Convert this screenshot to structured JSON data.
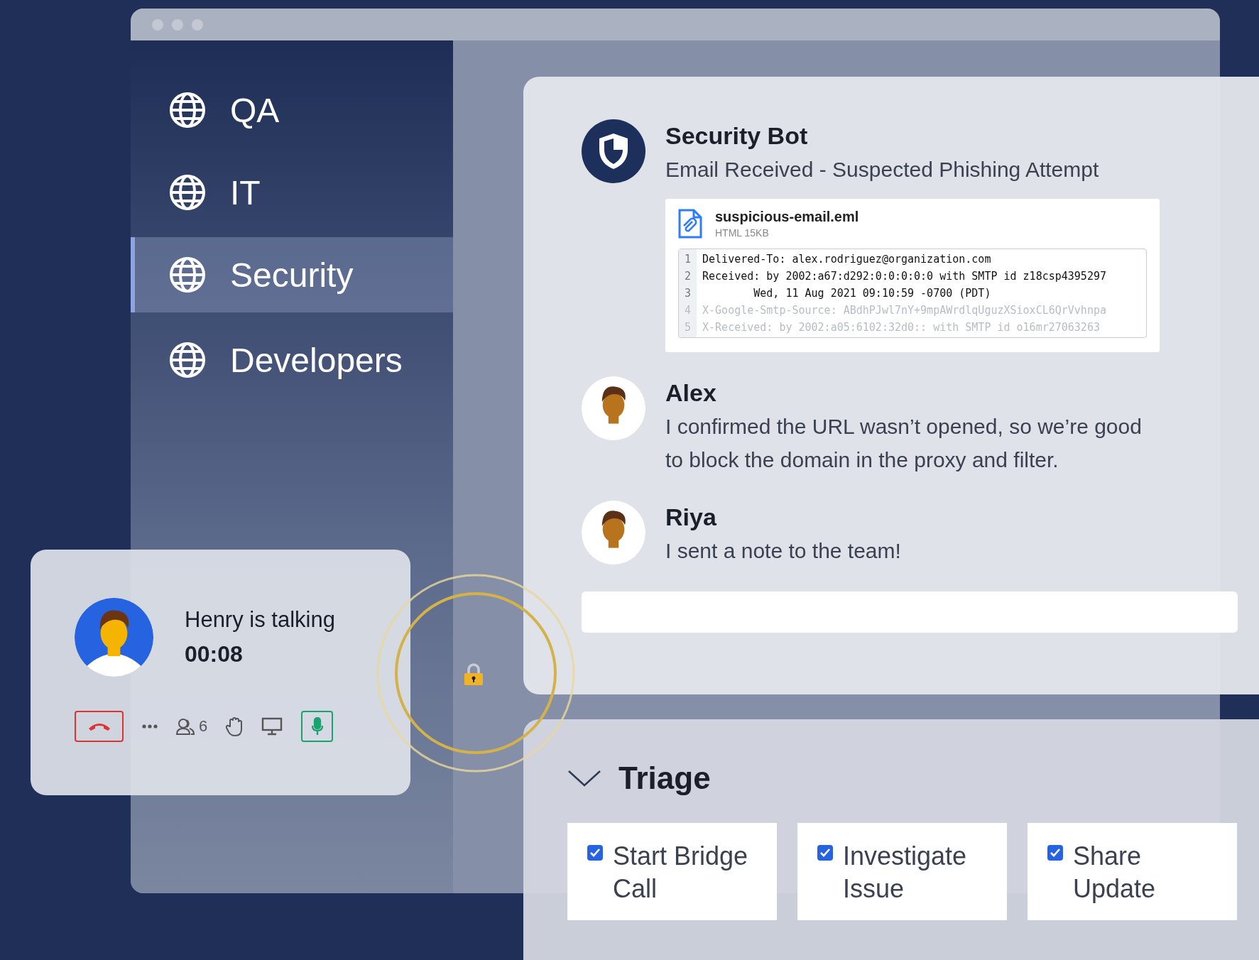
{
  "sidebar": {
    "items": [
      {
        "label": "QA",
        "selected": false
      },
      {
        "label": "IT",
        "selected": false
      },
      {
        "label": "Security",
        "selected": true
      },
      {
        "label": "Developers",
        "selected": false
      }
    ]
  },
  "chat": {
    "messages": [
      {
        "kind": "bot",
        "author": "Security Bot",
        "text": "Email Received - Suspected Phishing Attempt",
        "attachment": {
          "filename": "suspicious-email.eml",
          "meta": "HTML 15KB",
          "lines": [
            {
              "number": "1",
              "text": "Delivered-To: alex.rodriguez@organization.com",
              "faded": false
            },
            {
              "number": "2",
              "text": "Received: by 2002:a67:d292:0:0:0:0:0 with SMTP id z18csp4395297",
              "faded": false
            },
            {
              "number": "3",
              "text": "        Wed, 11 Aug 2021 09:10:59 -0700 (PDT)",
              "faded": false
            },
            {
              "number": "4",
              "text": "X-Google-Smtp-Source: ABdhPJwl7nY+9mpAWrdlqUguzXSioxCL6QrVvhnpa",
              "faded": true
            },
            {
              "number": "5",
              "text": "X-Received: by 2002:a05:6102:32d0:: with SMTP id o16mr27063263",
              "faded": true
            }
          ]
        }
      },
      {
        "kind": "person",
        "author": "Alex",
        "text": "I confirmed the URL wasn’t opened, so we’re good to block the domain in the proxy and filter."
      },
      {
        "kind": "person",
        "author": "Riya",
        "text": "I sent a note to the team!"
      }
    ]
  },
  "call": {
    "status": "Henry is talking",
    "duration": "00:08",
    "participants": "6",
    "mic_on": true
  },
  "triage": {
    "title": "Triage",
    "expanded": true,
    "tasks": [
      {
        "label": "Start Bridge Call",
        "checked": true
      },
      {
        "label": "Investigate Issue",
        "checked": true
      },
      {
        "label": "Share Update",
        "checked": true
      }
    ]
  }
}
